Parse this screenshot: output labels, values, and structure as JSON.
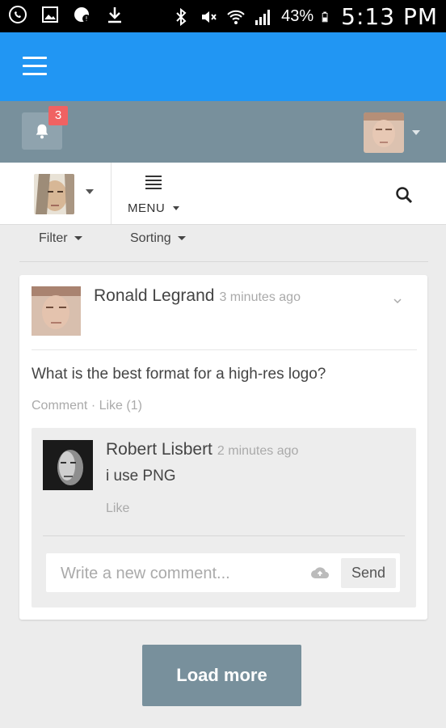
{
  "status_bar": {
    "battery": "43%",
    "time": "5:13 PM",
    "icons": [
      "whatsapp-icon",
      "gallery-icon",
      "notification-icon",
      "download-icon",
      "bluetooth-icon",
      "mute-icon",
      "wifi-icon",
      "signal-icon",
      "battery-icon"
    ]
  },
  "app_bar": {
    "menu_icon": "hamburger-icon",
    "color": "#2196f3"
  },
  "user_bar": {
    "notifications_count": "3",
    "color": "#78909c"
  },
  "toolbar": {
    "menu_label": "MENU"
  },
  "filters": {
    "filter_label": "Filter",
    "sorting_label": "Sorting"
  },
  "post": {
    "author": "Ronald Legrand",
    "time": "3 minutes ago",
    "text": "What is the best format for a high-res logo?",
    "comment_action": "Comment",
    "separator": "·",
    "like_action": "Like (1)"
  },
  "comment": {
    "author": "Robert Lisbert",
    "time": "2 minutes ago",
    "text": "i use PNG",
    "like_action": "Like"
  },
  "new_comment": {
    "placeholder": "Write a new comment...",
    "value": "",
    "send_label": "Send"
  },
  "load_more_label": "Load more"
}
